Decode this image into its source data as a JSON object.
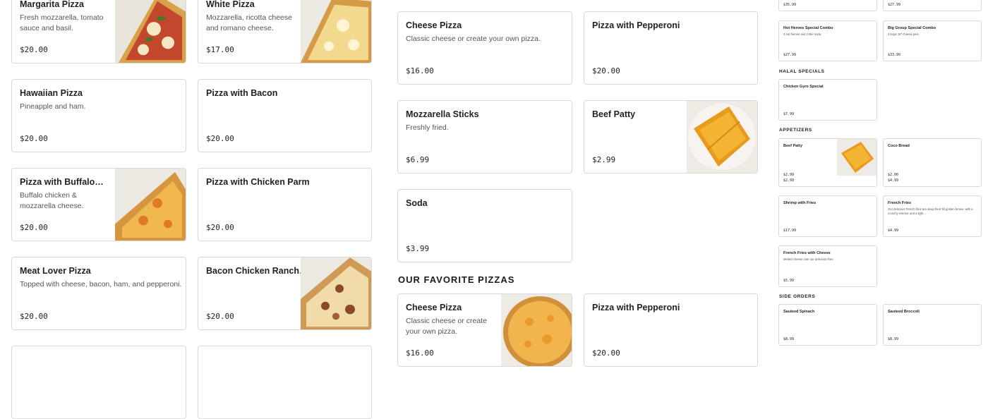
{
  "left_grid": [
    {
      "name": "Margarita Pizza",
      "desc": "Fresh mozzarella, tomato sauce and basil.",
      "price": "$20.00"
    },
    {
      "name": "White Pizza",
      "desc": "Mozzarella, ricotta cheese and romano cheese.",
      "price": "$17.00"
    },
    {
      "name": "Hawaiian Pizza",
      "desc": "Pineapple and ham.",
      "price": "$20.00"
    },
    {
      "name": "Pizza with Bacon",
      "desc": "",
      "price": "$20.00"
    },
    {
      "name": "Pizza with Buffalo…",
      "desc": "Buffalo chicken & mozzarella cheese.",
      "price": "$20.00"
    },
    {
      "name": "Pizza with Chicken Parm",
      "desc": "",
      "price": "$20.00"
    },
    {
      "name": "Meat Lover Pizza",
      "desc": "Topped with cheese, bacon, ham, and pepperoni.",
      "price": "$20.00"
    },
    {
      "name": "Bacon Chicken Ranch…",
      "desc": "",
      "price": "$20.00"
    }
  ],
  "middle": {
    "top_items": [
      {
        "name": "Cheese Pizza",
        "desc": "Classic cheese or create your own pizza.",
        "price": "$16.00"
      },
      {
        "name": "Pizza with Pepperoni",
        "desc": "",
        "price": "$20.00"
      },
      {
        "name": "Mozzarella Sticks",
        "desc": "Freshly fried.",
        "price": "$6.99"
      },
      {
        "name": "Beef Patty",
        "desc": "",
        "price": "$2.99"
      },
      {
        "name": "Soda",
        "desc": "",
        "price": "$3.99"
      }
    ],
    "section_title": "OUR FAVORITE PIZZAS",
    "favorites": [
      {
        "name": "Cheese Pizza",
        "desc": "Classic cheese or create your own pizza.",
        "price": "$16.00"
      },
      {
        "name": "Pizza with Pepperoni",
        "desc": "",
        "price": "$20.00"
      }
    ]
  },
  "right": {
    "top_prices": [
      "$35.99",
      "$27.99"
    ],
    "combos": [
      {
        "name": "Hot Heroes Special Combo",
        "desc": "3 hot heroes and 2 liter soda.",
        "price": "$27.99"
      },
      {
        "name": "Big Group Special Combo",
        "desc": "2 large 18\" cheese pies.",
        "price": "$33.99"
      }
    ],
    "halal_title": "HALAL SPECIALS",
    "halal": [
      {
        "name": "Chicken Gyro Special",
        "price": "$7.99"
      }
    ],
    "appetizers_title": "APPETIZERS",
    "appetizers": [
      {
        "name": "Beef Patty",
        "price": "$2.99",
        "price_b": "$2.99"
      },
      {
        "name": "Coco Bread",
        "price": "$2.00",
        "price_b": "$4.99"
      },
      {
        "name": "Shrimp with Fries",
        "desc": "",
        "price": "$17.99"
      },
      {
        "name": "French Fries",
        "desc": "Our delicious French fries are deep-fried 'till golden brown, with a crunchy exterior and a light…",
        "price": "$4.99"
      },
      {
        "name": "French Fries with Cheese",
        "desc": "Melted cheese over our delicious fries.",
        "price": "$5.99"
      }
    ],
    "side_title": "SIDE ORDERS",
    "sides": [
      {
        "name": "Sauteed Spinach",
        "price": "$8.99"
      },
      {
        "name": "Sauteed Broccoli",
        "price": "$8.99"
      }
    ]
  },
  "colors": {
    "border": "#d9d9d9",
    "text": "#1a1a1a",
    "muted": "#555555",
    "crust": "#d99a3c",
    "cheese": "#f2c45a"
  }
}
